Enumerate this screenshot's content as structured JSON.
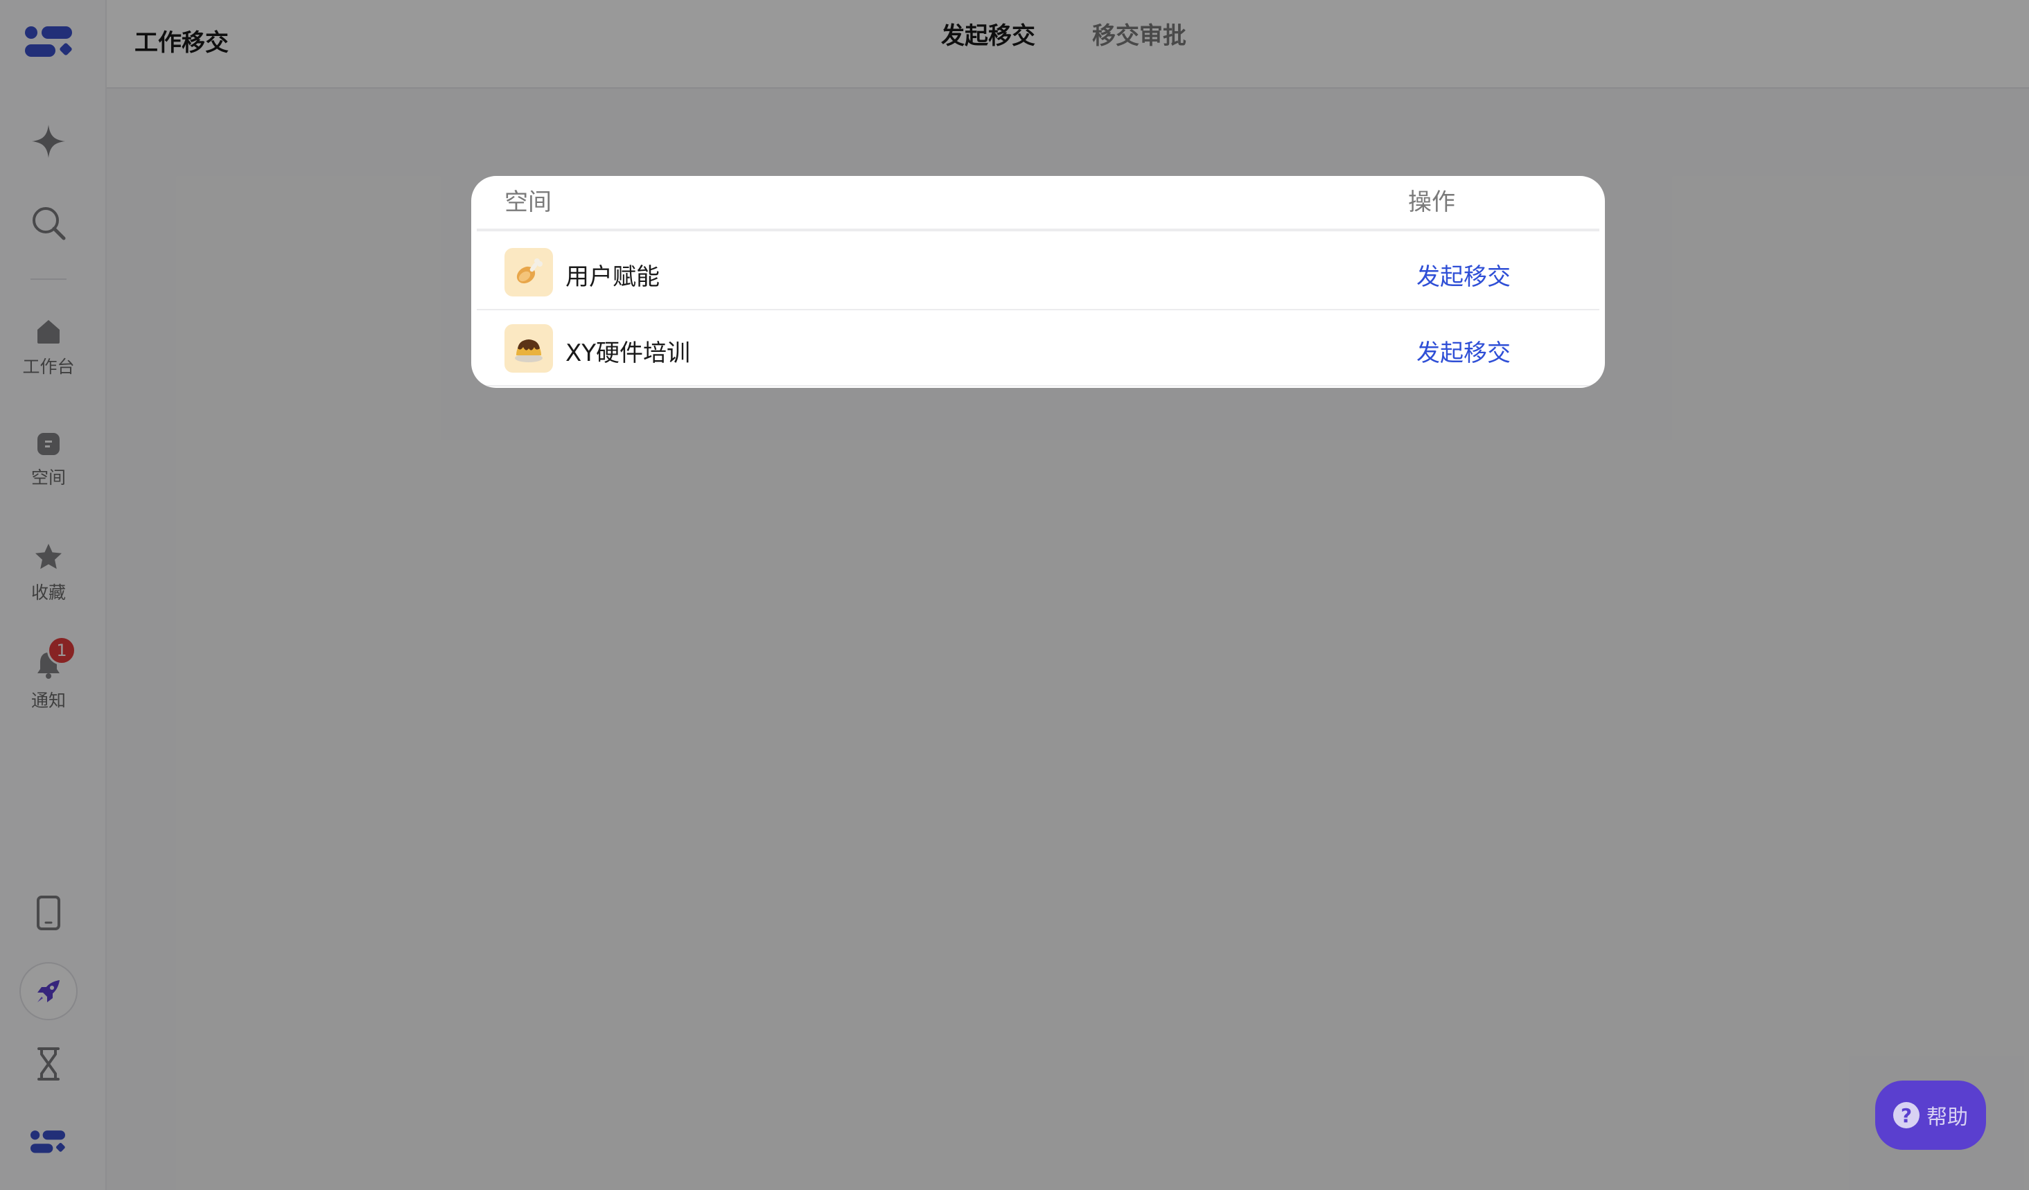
{
  "header": {
    "title": "工作移交",
    "tabs": [
      {
        "label": "发起移交",
        "active": true
      },
      {
        "label": "移交审批",
        "active": false
      }
    ]
  },
  "sidebar": {
    "items": [
      {
        "label": "工作台",
        "icon": "home-icon"
      },
      {
        "label": "空间",
        "icon": "space-icon"
      },
      {
        "label": "收藏",
        "icon": "star-icon"
      },
      {
        "label": "通知",
        "icon": "bell-icon",
        "badge": "1"
      }
    ],
    "top_icons": [
      "sparkle-icon",
      "search-icon"
    ],
    "bottom_icons": [
      "mobile-icon",
      "rocket-icon",
      "hourglass-icon",
      "app-logo-icon"
    ]
  },
  "modal": {
    "columns": {
      "space": "空间",
      "action": "操作"
    },
    "rows": [
      {
        "name": "用户赋能",
        "action": "发起移交",
        "icon": "chicken-leg-icon"
      },
      {
        "name": "XY硬件培训",
        "action": "发起移交",
        "icon": "pudding-icon"
      }
    ]
  },
  "help": {
    "label": "帮助"
  },
  "colors": {
    "accent_link": "#2f4fd6",
    "help_button": "#5a3fcf",
    "badge": "#e23b3b",
    "brand": "#3a4fc8"
  }
}
